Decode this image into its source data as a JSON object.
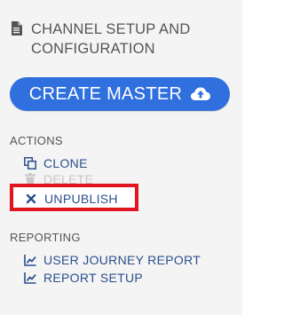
{
  "header": {
    "icon": "document-icon",
    "title": "CHANNEL SETUP AND CONFIGURATION"
  },
  "create_button": {
    "label": "CREATE MASTER",
    "icon": "cloud-upload-icon"
  },
  "actions": {
    "label": "ACTIONS",
    "items": [
      {
        "label": "CLONE",
        "icon": "clone-icon"
      },
      {
        "label": "DELETE",
        "icon": "trash-icon"
      },
      {
        "label": "UNPUBLISH",
        "icon": "close-icon"
      }
    ]
  },
  "reporting": {
    "label": "REPORTING",
    "items": [
      {
        "label": "USER JOURNEY REPORT",
        "icon": "line-chart-icon"
      },
      {
        "label": "REPORT SETUP",
        "icon": "line-chart-icon"
      }
    ]
  },
  "colors": {
    "accent": "#2f6fde",
    "link": "#2b4f8c",
    "highlight_border": "#e2141f",
    "panel_bg": "#f4f4f4"
  }
}
